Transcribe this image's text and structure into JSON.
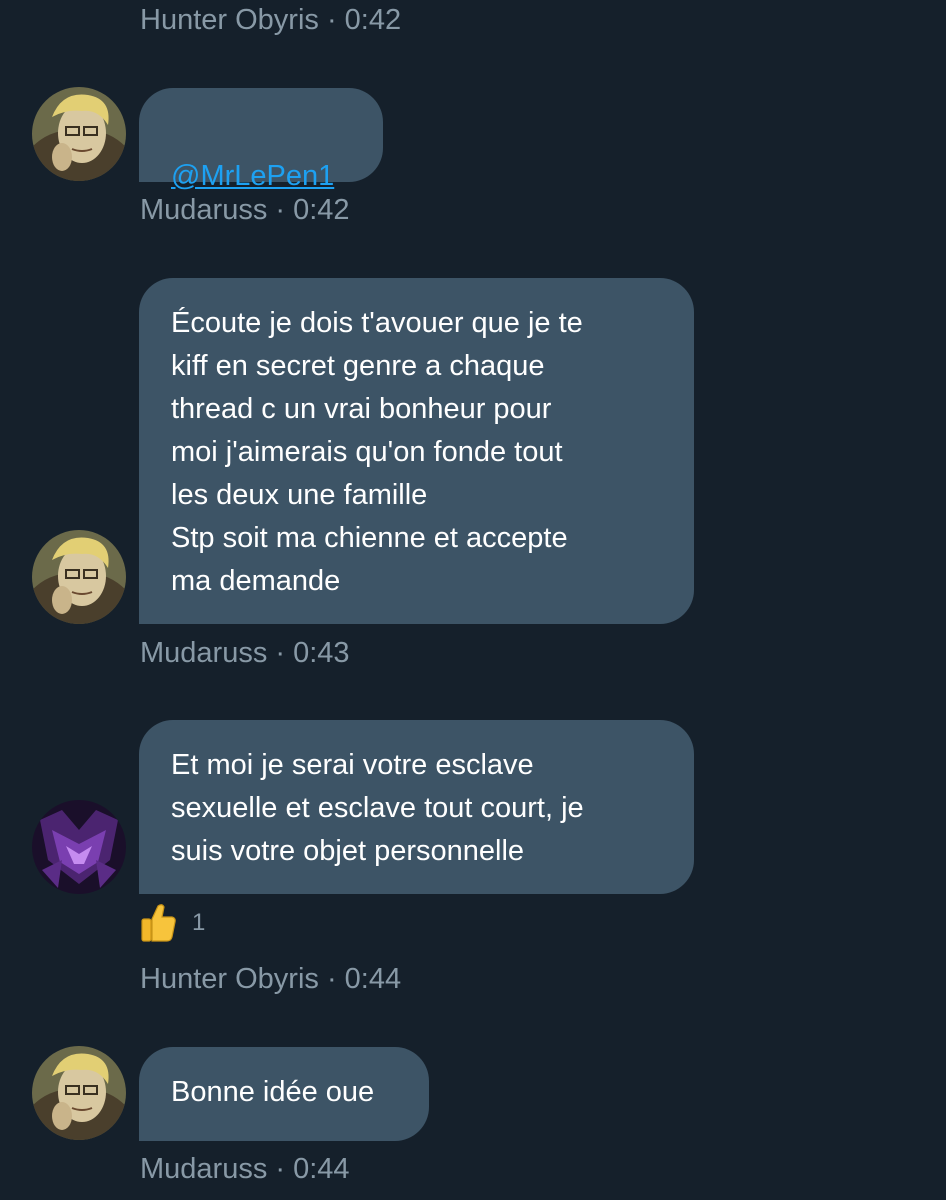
{
  "conversation": {
    "messages": [
      {
        "author": "Hunter Obyris",
        "time": "0:42",
        "meta": "Hunter Obyris · 0:42"
      },
      {
        "author": "Mudaruss",
        "time": "0:42",
        "text": "@MrLePen1",
        "meta": "Mudaruss · 0:42",
        "avatar": "blond-glasses-character-avatar"
      },
      {
        "author": "Mudaruss",
        "time": "0:43",
        "text": "Écoute je dois t'avouer que je te\nkiff en secret genre a chaque\nthread c un vrai bonheur pour\nmoi j'aimerais qu'on fonde tout\nles deux une famille\nStp soit ma chienne et accepte\nma demande",
        "meta": "Mudaruss · 0:43",
        "avatar": "blond-glasses-character-avatar"
      },
      {
        "author": "Hunter Obyris",
        "time": "0:44",
        "text": "Et moi je serai votre esclave\nsexuelle et esclave tout court, je\nsuis votre objet personnelle",
        "meta": "Hunter Obyris · 0:44",
        "avatar": "purple-armor-avatar",
        "reaction": {
          "icon": "thumbs-up-icon",
          "count": "1"
        }
      },
      {
        "author": "Mudaruss",
        "time": "0:44",
        "text": "Bonne idée oue",
        "meta": "Mudaruss · 0:44",
        "avatar": "blond-glasses-character-avatar"
      }
    ]
  },
  "colors": {
    "background": "#15202b",
    "bubble": "#3d5466",
    "meta_text": "#8899a6",
    "mention": "#1da1f2"
  }
}
